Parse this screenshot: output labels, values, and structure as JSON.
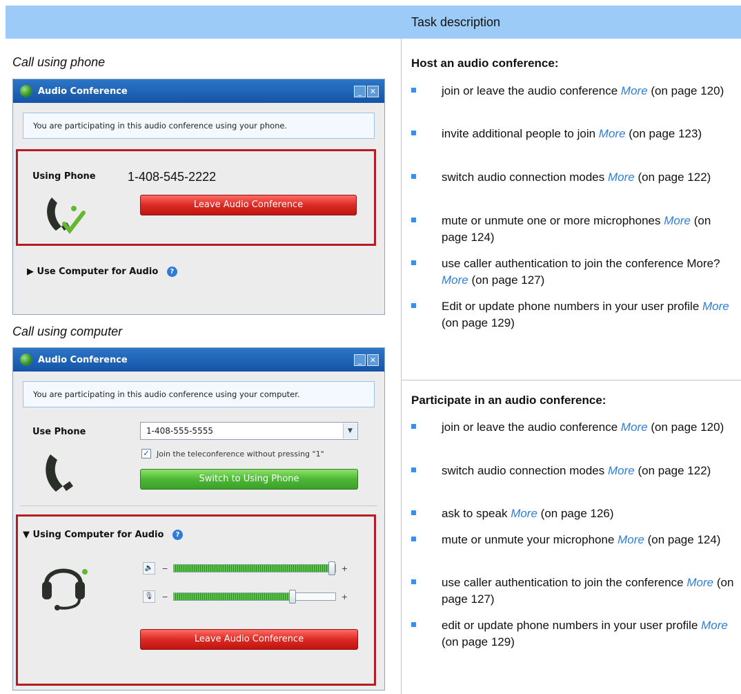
{
  "header": {
    "task_description_label": "Task description"
  },
  "left": {
    "phone_caption": "Call using phone",
    "computer_caption": "Call using computer",
    "phone_window": {
      "title": "Audio Conference",
      "notice": "You are participating in this audio conference using your phone.",
      "using_phone_label": "Using Phone",
      "phone_number": "1-408-545-2222",
      "leave_button": "Leave Audio Conference",
      "use_computer_toggle": "Use Computer for Audio"
    },
    "computer_window": {
      "title": "Audio Conference",
      "notice": "You are participating in this audio conference using your computer.",
      "use_phone_label": "Use Phone",
      "phone_select_value": "1-408-555-5555",
      "checkbox_label": "Join the teleconference without pressing \"1\"",
      "checkbox_checked": true,
      "switch_button": "Switch to Using Phone",
      "using_computer_toggle": "Using Computer for Audio",
      "speaker_level": 0.98,
      "mic_level": 0.74,
      "leave_button": "Leave Audio Conference"
    }
  },
  "right": {
    "host_heading": "Host an audio conference:",
    "host_items": [
      {
        "text": "join or leave the audio conference",
        "more": "More",
        "page": "(on page 120)"
      },
      {
        "text": "invite additional people to join",
        "more": "More",
        "page": "(on page 123)"
      },
      {
        "text": "switch audio connection modes",
        "more": "More",
        "page": "(on page 122)"
      },
      {
        "text": "mute or unmute one or more microphones",
        "more": "More",
        "page": "(on page 124)"
      },
      {
        "text": "use caller authentication to join the conference More?",
        "more": "More",
        "page": "(on page 127)"
      },
      {
        "text": "Edit or update phone numbers in your user profile",
        "more": "More",
        "page": "(on page 129)"
      }
    ],
    "participate_heading": "Participate in an audio conference:",
    "participate_items": [
      {
        "text": "join or leave the audio conference",
        "more": "More",
        "page": "(on page 120)"
      },
      {
        "text": "switch audio connection modes",
        "more": "More",
        "page": "(on page 122)"
      },
      {
        "text": "ask to speak",
        "more": "More",
        "page": "(on page 126)"
      },
      {
        "text": "mute or unmute your microphone",
        "more": "More",
        "page": "(on page 124)"
      },
      {
        "text": "use caller authentication to join the conference",
        "more": "More",
        "page": "(on page 127)"
      },
      {
        "text": "edit or update phone numbers in your user profile",
        "more": "More",
        "page": "(on page 129)"
      }
    ]
  },
  "colors": {
    "header_bg": "#9ccbf8",
    "link": "#2e7fd9",
    "bullet": "#3d8fe6",
    "highlight_box": "#b31c22"
  }
}
